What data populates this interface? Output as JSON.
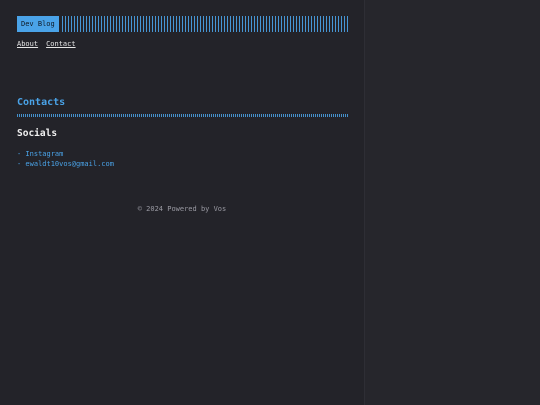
{
  "header": {
    "logo_text": "Dev Blog"
  },
  "nav": {
    "items": [
      {
        "label": "About"
      },
      {
        "label": "Contact"
      }
    ]
  },
  "main": {
    "section_title": "Contacts",
    "socials_title": "Socials",
    "socials": [
      {
        "label": "- Instagram"
      },
      {
        "label": "- ewaldt10vos@gmail.com"
      }
    ]
  },
  "footer": {
    "text": "© 2024 Powered by Vos"
  },
  "colors": {
    "accent": "#4aa3e8",
    "background": "#232329"
  }
}
